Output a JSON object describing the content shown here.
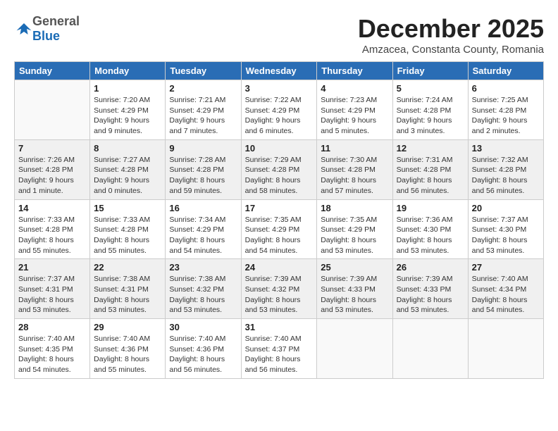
{
  "logo": {
    "general": "General",
    "blue": "Blue"
  },
  "title": "December 2025",
  "subtitle": "Amzacea, Constanta County, Romania",
  "days_of_week": [
    "Sunday",
    "Monday",
    "Tuesday",
    "Wednesday",
    "Thursday",
    "Friday",
    "Saturday"
  ],
  "weeks": [
    [
      {
        "day": "",
        "info": ""
      },
      {
        "day": "1",
        "info": "Sunrise: 7:20 AM\nSunset: 4:29 PM\nDaylight: 9 hours\nand 9 minutes."
      },
      {
        "day": "2",
        "info": "Sunrise: 7:21 AM\nSunset: 4:29 PM\nDaylight: 9 hours\nand 7 minutes."
      },
      {
        "day": "3",
        "info": "Sunrise: 7:22 AM\nSunset: 4:29 PM\nDaylight: 9 hours\nand 6 minutes."
      },
      {
        "day": "4",
        "info": "Sunrise: 7:23 AM\nSunset: 4:29 PM\nDaylight: 9 hours\nand 5 minutes."
      },
      {
        "day": "5",
        "info": "Sunrise: 7:24 AM\nSunset: 4:28 PM\nDaylight: 9 hours\nand 3 minutes."
      },
      {
        "day": "6",
        "info": "Sunrise: 7:25 AM\nSunset: 4:28 PM\nDaylight: 9 hours\nand 2 minutes."
      }
    ],
    [
      {
        "day": "7",
        "info": "Sunrise: 7:26 AM\nSunset: 4:28 PM\nDaylight: 9 hours\nand 1 minute."
      },
      {
        "day": "8",
        "info": "Sunrise: 7:27 AM\nSunset: 4:28 PM\nDaylight: 9 hours\nand 0 minutes."
      },
      {
        "day": "9",
        "info": "Sunrise: 7:28 AM\nSunset: 4:28 PM\nDaylight: 8 hours\nand 59 minutes."
      },
      {
        "day": "10",
        "info": "Sunrise: 7:29 AM\nSunset: 4:28 PM\nDaylight: 8 hours\nand 58 minutes."
      },
      {
        "day": "11",
        "info": "Sunrise: 7:30 AM\nSunset: 4:28 PM\nDaylight: 8 hours\nand 57 minutes."
      },
      {
        "day": "12",
        "info": "Sunrise: 7:31 AM\nSunset: 4:28 PM\nDaylight: 8 hours\nand 56 minutes."
      },
      {
        "day": "13",
        "info": "Sunrise: 7:32 AM\nSunset: 4:28 PM\nDaylight: 8 hours\nand 56 minutes."
      }
    ],
    [
      {
        "day": "14",
        "info": "Sunrise: 7:33 AM\nSunset: 4:28 PM\nDaylight: 8 hours\nand 55 minutes."
      },
      {
        "day": "15",
        "info": "Sunrise: 7:33 AM\nSunset: 4:28 PM\nDaylight: 8 hours\nand 55 minutes."
      },
      {
        "day": "16",
        "info": "Sunrise: 7:34 AM\nSunset: 4:29 PM\nDaylight: 8 hours\nand 54 minutes."
      },
      {
        "day": "17",
        "info": "Sunrise: 7:35 AM\nSunset: 4:29 PM\nDaylight: 8 hours\nand 54 minutes."
      },
      {
        "day": "18",
        "info": "Sunrise: 7:35 AM\nSunset: 4:29 PM\nDaylight: 8 hours\nand 53 minutes."
      },
      {
        "day": "19",
        "info": "Sunrise: 7:36 AM\nSunset: 4:30 PM\nDaylight: 8 hours\nand 53 minutes."
      },
      {
        "day": "20",
        "info": "Sunrise: 7:37 AM\nSunset: 4:30 PM\nDaylight: 8 hours\nand 53 minutes."
      }
    ],
    [
      {
        "day": "21",
        "info": "Sunrise: 7:37 AM\nSunset: 4:31 PM\nDaylight: 8 hours\nand 53 minutes."
      },
      {
        "day": "22",
        "info": "Sunrise: 7:38 AM\nSunset: 4:31 PM\nDaylight: 8 hours\nand 53 minutes."
      },
      {
        "day": "23",
        "info": "Sunrise: 7:38 AM\nSunset: 4:32 PM\nDaylight: 8 hours\nand 53 minutes."
      },
      {
        "day": "24",
        "info": "Sunrise: 7:39 AM\nSunset: 4:32 PM\nDaylight: 8 hours\nand 53 minutes."
      },
      {
        "day": "25",
        "info": "Sunrise: 7:39 AM\nSunset: 4:33 PM\nDaylight: 8 hours\nand 53 minutes."
      },
      {
        "day": "26",
        "info": "Sunrise: 7:39 AM\nSunset: 4:33 PM\nDaylight: 8 hours\nand 53 minutes."
      },
      {
        "day": "27",
        "info": "Sunrise: 7:40 AM\nSunset: 4:34 PM\nDaylight: 8 hours\nand 54 minutes."
      }
    ],
    [
      {
        "day": "28",
        "info": "Sunrise: 7:40 AM\nSunset: 4:35 PM\nDaylight: 8 hours\nand 54 minutes."
      },
      {
        "day": "29",
        "info": "Sunrise: 7:40 AM\nSunset: 4:36 PM\nDaylight: 8 hours\nand 55 minutes."
      },
      {
        "day": "30",
        "info": "Sunrise: 7:40 AM\nSunset: 4:36 PM\nDaylight: 8 hours\nand 56 minutes."
      },
      {
        "day": "31",
        "info": "Sunrise: 7:40 AM\nSunset: 4:37 PM\nDaylight: 8 hours\nand 56 minutes."
      },
      {
        "day": "",
        "info": ""
      },
      {
        "day": "",
        "info": ""
      },
      {
        "day": "",
        "info": ""
      }
    ]
  ]
}
